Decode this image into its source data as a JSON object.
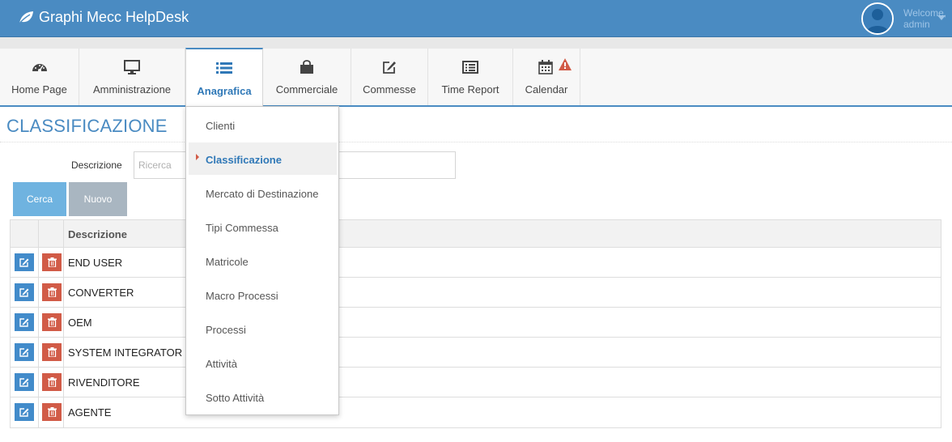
{
  "app": {
    "title": "Graphi Mecc HelpDesk"
  },
  "user": {
    "welcome": "Welcome,",
    "name": "admin"
  },
  "nav": {
    "tabs": [
      {
        "label": "Home Page",
        "icon": "dashboard-icon"
      },
      {
        "label": "Amministrazione",
        "icon": "desktop-icon"
      },
      {
        "label": "Anagrafica",
        "icon": "list-icon",
        "active": true
      },
      {
        "label": "Commerciale",
        "icon": "shopping-bag-icon"
      },
      {
        "label": "Commesse",
        "icon": "edit-icon"
      },
      {
        "label": "Time Report",
        "icon": "list-alt-icon"
      },
      {
        "label": "Calendar",
        "icon": "calendar-icon",
        "alert": true
      }
    ]
  },
  "dropdown": {
    "items": [
      {
        "label": "Clienti"
      },
      {
        "label": "Classificazione",
        "selected": true
      },
      {
        "label": "Mercato di Destinazione"
      },
      {
        "label": "Tipi Commessa"
      },
      {
        "label": "Matricole"
      },
      {
        "label": "Macro Processi"
      },
      {
        "label": "Processi"
      },
      {
        "label": "Attività"
      },
      {
        "label": "Sotto Attività"
      }
    ]
  },
  "page": {
    "title": "CLASSIFICAZIONE"
  },
  "search": {
    "label": "Descrizione",
    "placeholder": "Ricerca",
    "value": ""
  },
  "buttons": {
    "search": "Cerca",
    "new": "Nuovo"
  },
  "table": {
    "header": "Descrizione",
    "rows": [
      "END USER",
      "CONVERTER",
      "OEM",
      "SYSTEM INTEGRATOR",
      "RIVENDITORE",
      "AGENTE"
    ]
  },
  "colors": {
    "header": "#4a8bc2",
    "accent": "#2f78b7",
    "edit": "#428bca",
    "delete": "#d15b47",
    "search_button": "#6fb3e0",
    "new_button": "#a9b6c1"
  }
}
